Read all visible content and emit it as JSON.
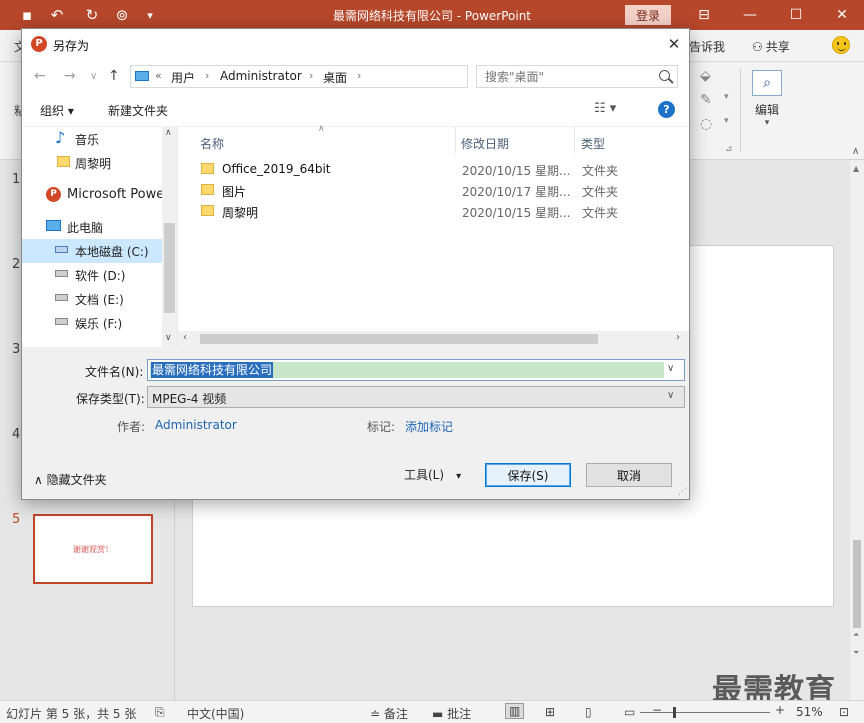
{
  "app": {
    "window_title": "最需网络科技有限公司  -  PowerPoint",
    "login_label": "登录",
    "tell_me": "告诉我",
    "share": "共享",
    "ribbon_tab_partial": "文",
    "edit_group_label": "编辑",
    "left_ribbon_partial": "粘"
  },
  "thumbnails": {
    "numbers": [
      "1",
      "2",
      "3",
      "4",
      "5"
    ],
    "slide5_text": "谢谢观赏！",
    "accent_color": "#c0472b"
  },
  "statusbar": {
    "slide_info": "幻灯片 第 5 张，共 5 张",
    "language": "中文(中国)",
    "notes": "备注",
    "comments": "批注",
    "zoom": "51%",
    "zoom_level": 0.51
  },
  "watermark": "最需教育",
  "dialog": {
    "title": "另存为",
    "address": {
      "prefix": "«",
      "crumbs": [
        "用户",
        "Administrator",
        "桌面"
      ]
    },
    "search_placeholder": "搜索\"桌面\"",
    "toolbar": {
      "organize": "组织 ▾",
      "new_folder": "新建文件夹"
    },
    "nav_items": [
      {
        "label": "音乐",
        "icon": "music-note-icon"
      },
      {
        "label": "周黎明",
        "icon": "folder-icon"
      },
      {
        "label": "Microsoft PowerPoint",
        "icon": "powerpoint-icon"
      },
      {
        "label": "此电脑",
        "icon": "computer-icon"
      },
      {
        "label": "本地磁盘 (C:)",
        "icon": "system-drive-icon"
      },
      {
        "label": "软件 (D:)",
        "icon": "drive-icon"
      },
      {
        "label": "文档 (E:)",
        "icon": "drive-icon"
      },
      {
        "label": "娱乐 (F:)",
        "icon": "drive-icon"
      }
    ],
    "columns": {
      "name": "名称",
      "modified": "修改日期",
      "type": "类型"
    },
    "files": [
      {
        "name": "Office_2019_64bit",
        "modified": "2020/10/15 星期...",
        "type": "文件夹"
      },
      {
        "name": "图片",
        "modified": "2020/10/17 星期...",
        "type": "文件夹"
      },
      {
        "name": "周黎明",
        "modified": "2020/10/15 星期...",
        "type": "文件夹"
      }
    ],
    "fields": {
      "filename_label": "文件名(N):",
      "filename_value": "最需网络科技有限公司",
      "filetype_label": "保存类型(T):",
      "filetype_value": "MPEG-4 视频",
      "author_label": "作者:",
      "author_value": "Administrator",
      "tags_label": "标记:",
      "tags_value": "添加标记"
    },
    "footer": {
      "hide_folders": "隐藏文件夹",
      "tools": "工具(L)",
      "save": "保存(S)",
      "cancel": "取消"
    }
  },
  "colors": {
    "titlebar": "#b7472a",
    "selection": "#2a6fbd",
    "link": "#1e64b4"
  }
}
